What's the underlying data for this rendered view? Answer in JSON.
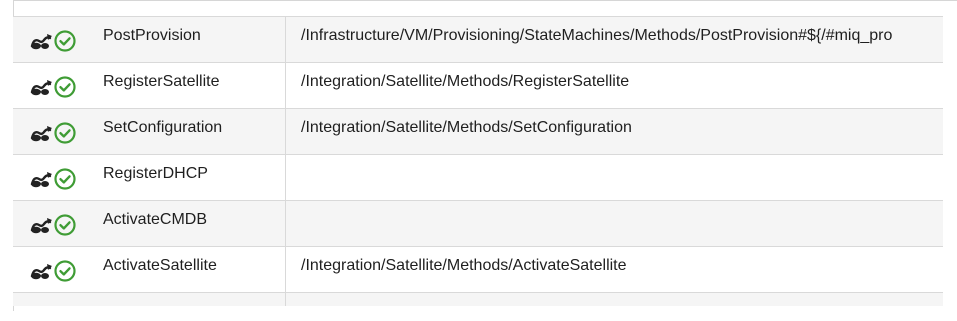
{
  "table": {
    "rows": [
      {
        "name": "PostProvision",
        "path": "/Infrastructure/VM/Provisioning/StateMachines/Methods/PostProvision#${/#miq_pro",
        "state_icon": "state-machine-icon",
        "status_icon": "check-circle-icon"
      },
      {
        "name": "RegisterSatellite",
        "path": "/Integration/Satellite/Methods/RegisterSatellite",
        "state_icon": "state-machine-icon",
        "status_icon": "check-circle-icon"
      },
      {
        "name": "SetConfiguration",
        "path": "/Integration/Satellite/Methods/SetConfiguration",
        "state_icon": "state-machine-icon",
        "status_icon": "check-circle-icon"
      },
      {
        "name": "RegisterDHCP",
        "path": "",
        "state_icon": "state-machine-icon",
        "status_icon": "check-circle-icon"
      },
      {
        "name": "ActivateCMDB",
        "path": "",
        "state_icon": "state-machine-icon",
        "status_icon": "check-circle-icon"
      },
      {
        "name": "ActivateSatellite",
        "path": "/Integration/Satellite/Methods/ActivateSatellite",
        "state_icon": "state-machine-icon",
        "status_icon": "check-circle-icon"
      }
    ]
  },
  "colors": {
    "check": "#3f9c35",
    "text": "#1f1f1f",
    "row_alt": "#f5f5f5",
    "border": "#d9d9d9"
  }
}
